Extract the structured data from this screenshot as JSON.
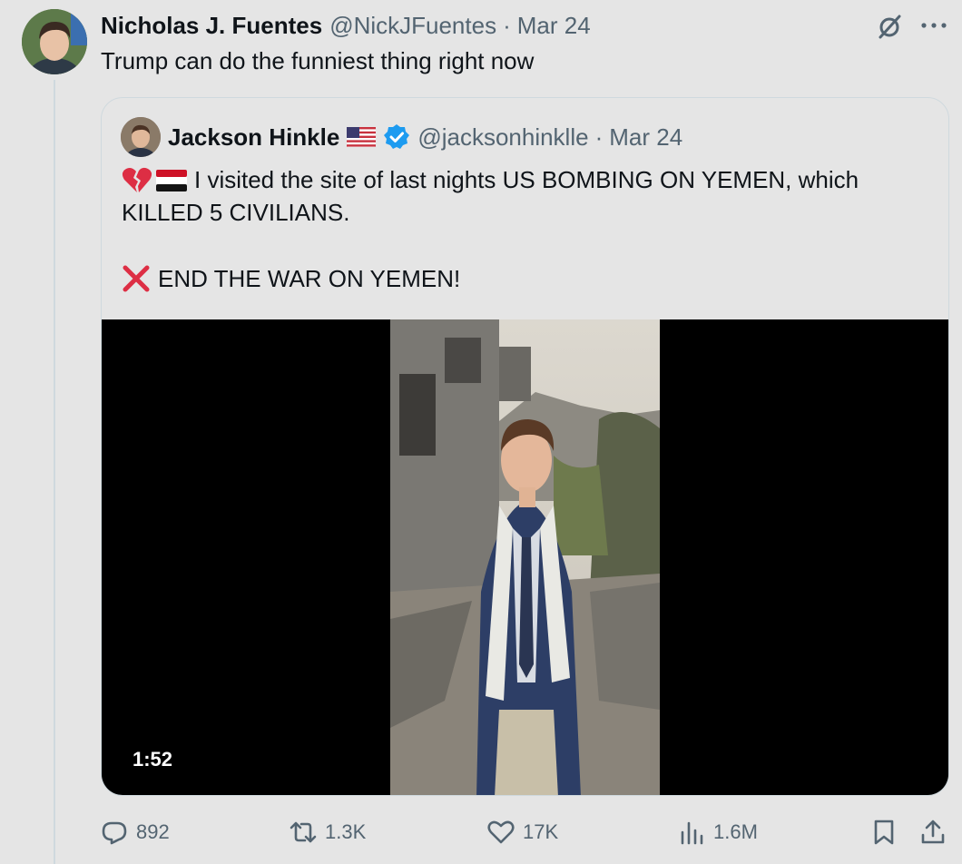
{
  "tweet": {
    "author_name": "Nicholas J. Fuentes",
    "handle": "@NickJFuentes",
    "separator": "·",
    "date": "Mar 24",
    "text": "Trump can do the funniest thing right now",
    "icons": [
      "grok-icon",
      "more-icon"
    ]
  },
  "quote": {
    "author_name": "Jackson Hinkle",
    "handle": "@jacksonhinklle",
    "separator": "·",
    "date": "Mar 24",
    "line1": "I visited the site of last nights US BOMBING ON YEMEN, which",
    "line2": "KILLED 5 CIVILIANS.",
    "line4": "END THE WAR ON YEMEN!",
    "emojis": [
      "broken-heart",
      "yemen-flag",
      "red-x",
      "us-flag"
    ],
    "video_duration": "1:52"
  },
  "actions": {
    "reply_count": "892",
    "retweet_count": "1.3K",
    "like_count": "17K",
    "views_count": "1.6M"
  },
  "colors": {
    "background": "#e5e5e5",
    "text": "#0f1419",
    "secondary": "#536471",
    "border": "#cfd9de",
    "verified": "#1d9bf0"
  }
}
